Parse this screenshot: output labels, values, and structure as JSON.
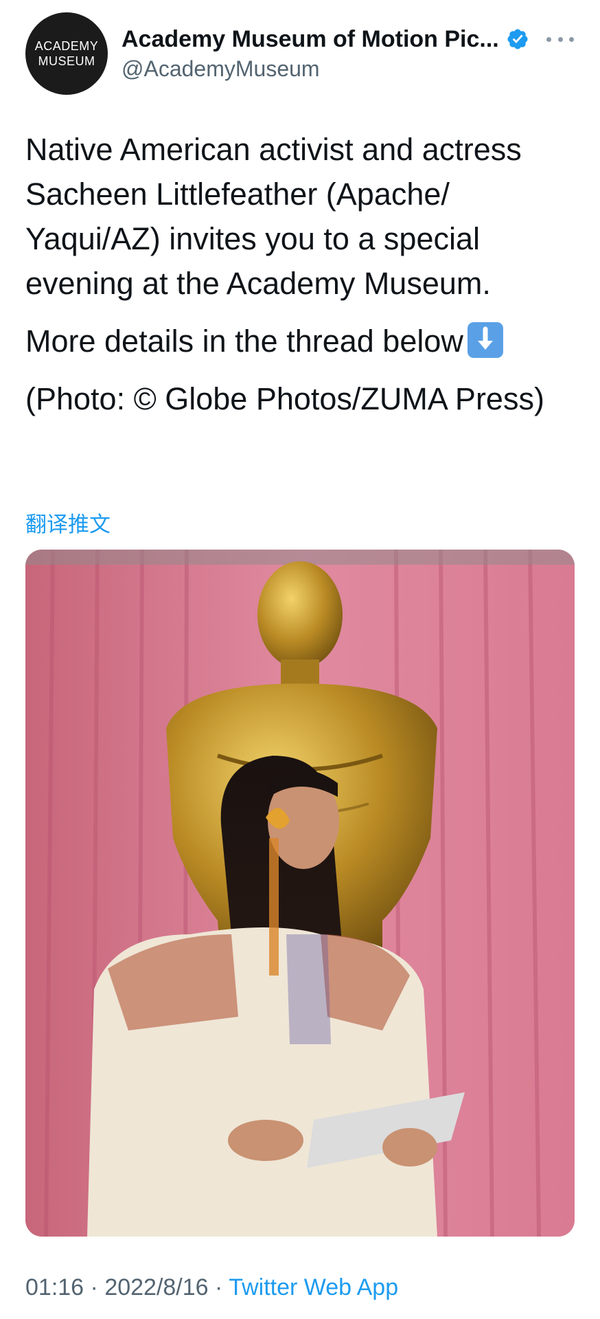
{
  "tweet": {
    "avatar_line1": "ACADEMY",
    "avatar_line2": "MUSEUM",
    "display_name": "Academy Museum of Motion Pic...",
    "handle": "@AcademyMuseum",
    "verified": true,
    "paragraphs": [
      "Native American activist and actress Sacheen Littlefeather (Apache/ Yaqui/AZ) invites you to a special evening at the Academy Museum.",
      "More details in the thread below",
      "(Photo: © Globe Photos/ZUMA Press)"
    ],
    "emoji": "down-arrow-emoji",
    "translate_label": "翻译推文",
    "media_alt": "photo",
    "time": "01:16",
    "separator": " · ",
    "date": "2022/8/16",
    "source": "Twitter Web App"
  },
  "colors": {
    "link": "#1d9bf0",
    "text": "#0f1419",
    "secondary": "#536471",
    "verified": "#1d9bf0"
  }
}
